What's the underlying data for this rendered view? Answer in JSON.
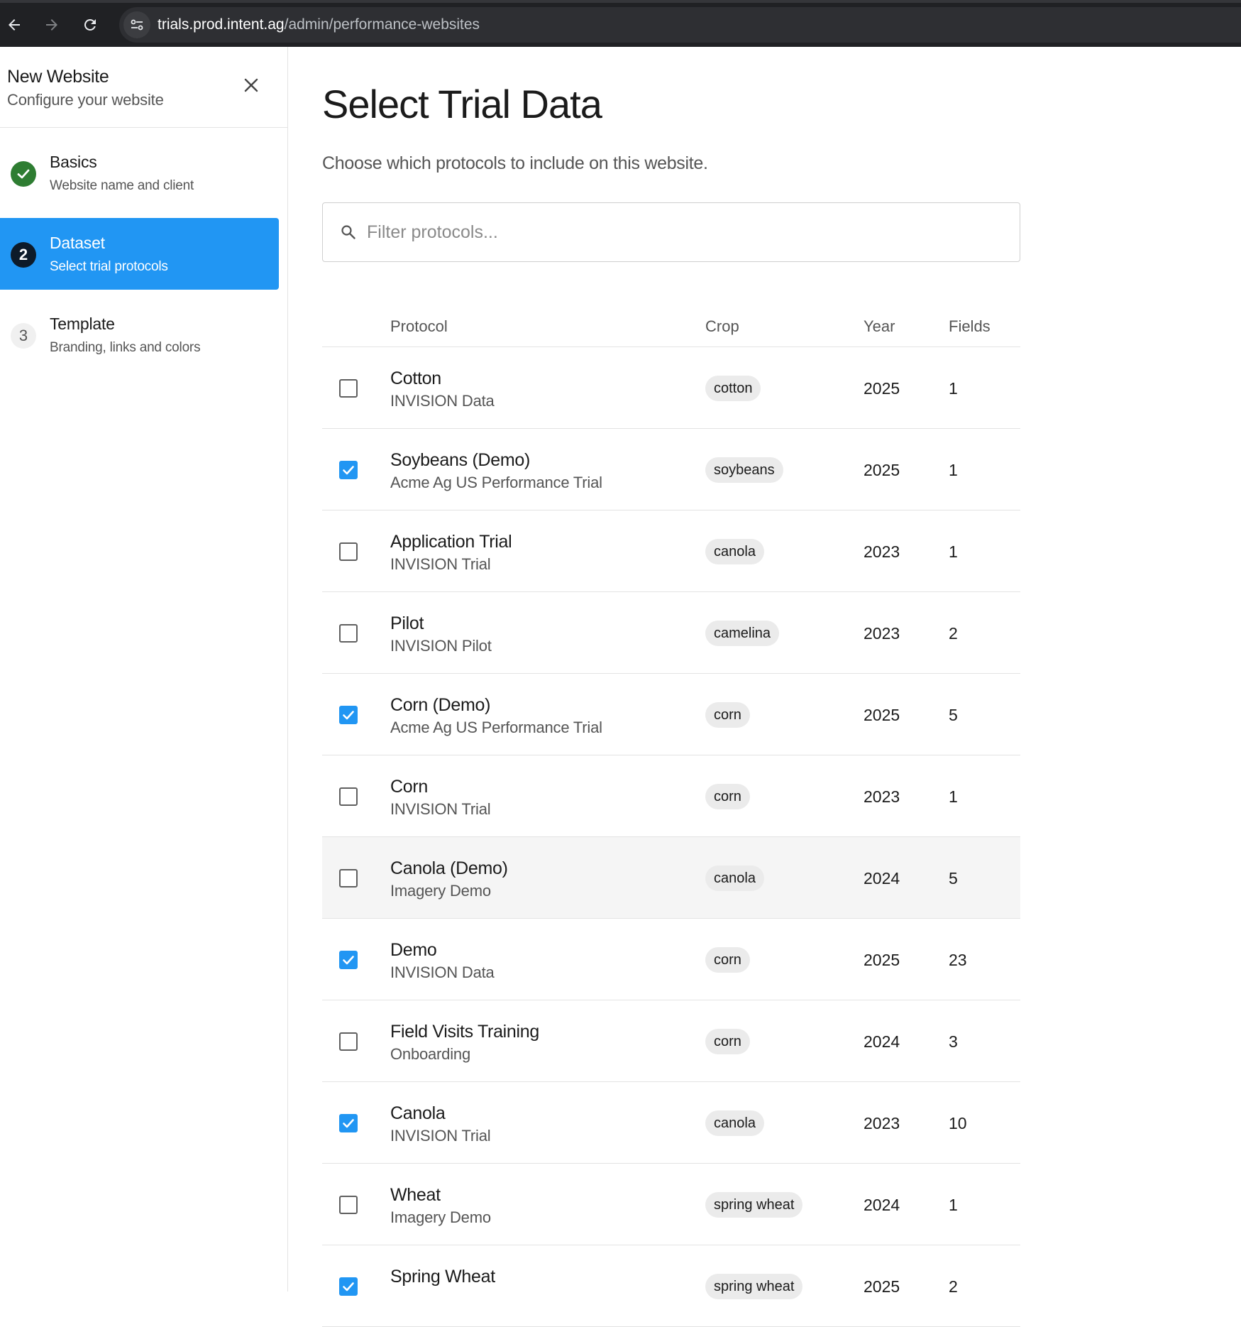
{
  "browser": {
    "url_host": "trials.prod.intent.ag",
    "url_path": "/admin/performance-websites"
  },
  "sidebar": {
    "title": "New Website",
    "subtitle": "Configure your website",
    "steps": [
      {
        "number": "",
        "title": "Basics",
        "desc": "Website name and client",
        "state": "done"
      },
      {
        "number": "2",
        "title": "Dataset",
        "desc": "Select trial protocols",
        "state": "current"
      },
      {
        "number": "3",
        "title": "Template",
        "desc": "Branding, links and colors",
        "state": "todo"
      }
    ]
  },
  "main": {
    "title": "Select Trial Data",
    "description": "Choose which protocols to include on this website.",
    "filter_placeholder": "Filter protocols...",
    "columns": {
      "protocol": "Protocol",
      "crop": "Crop",
      "year": "Year",
      "fields": "Fields"
    },
    "rows": [
      {
        "name": "Cotton",
        "org": "INVISION Data",
        "crop": "cotton",
        "year": "2025",
        "fields": "1",
        "checked": false
      },
      {
        "name": "Soybeans (Demo)",
        "org": "Acme Ag US Performance Trial",
        "crop": "soybeans",
        "year": "2025",
        "fields": "1",
        "checked": true
      },
      {
        "name": "Application Trial",
        "org": "INVISION Trial",
        "crop": "canola",
        "year": "2023",
        "fields": "1",
        "checked": false
      },
      {
        "name": "Pilot",
        "org": "INVISION Pilot",
        "crop": "camelina",
        "year": "2023",
        "fields": "2",
        "checked": false
      },
      {
        "name": "Corn (Demo)",
        "org": "Acme Ag US Performance Trial",
        "crop": "corn",
        "year": "2025",
        "fields": "5",
        "checked": true
      },
      {
        "name": "Corn",
        "org": "INVISION Trial",
        "crop": "corn",
        "year": "2023",
        "fields": "1",
        "checked": false
      },
      {
        "name": "Canola (Demo)",
        "org": "Imagery Demo",
        "crop": "canola",
        "year": "2024",
        "fields": "5",
        "checked": false,
        "hover": true
      },
      {
        "name": "Demo",
        "org": "INVISION Data",
        "crop": "corn",
        "year": "2025",
        "fields": "23",
        "checked": true
      },
      {
        "name": "Field Visits Training",
        "org": "Onboarding",
        "crop": "corn",
        "year": "2024",
        "fields": "3",
        "checked": false
      },
      {
        "name": "Canola",
        "org": "INVISION Trial",
        "crop": "canola",
        "year": "2023",
        "fields": "10",
        "checked": true
      },
      {
        "name": "Wheat",
        "org": "Imagery Demo",
        "crop": "spring wheat",
        "year": "2024",
        "fields": "1",
        "checked": false
      },
      {
        "name": "Spring Wheat",
        "org": "",
        "crop": "spring wheat",
        "year": "2025",
        "fields": "2",
        "checked": true
      }
    ]
  },
  "colors": {
    "accent": "#2196f3",
    "done": "#2e7d32",
    "chrome": "#202124"
  }
}
